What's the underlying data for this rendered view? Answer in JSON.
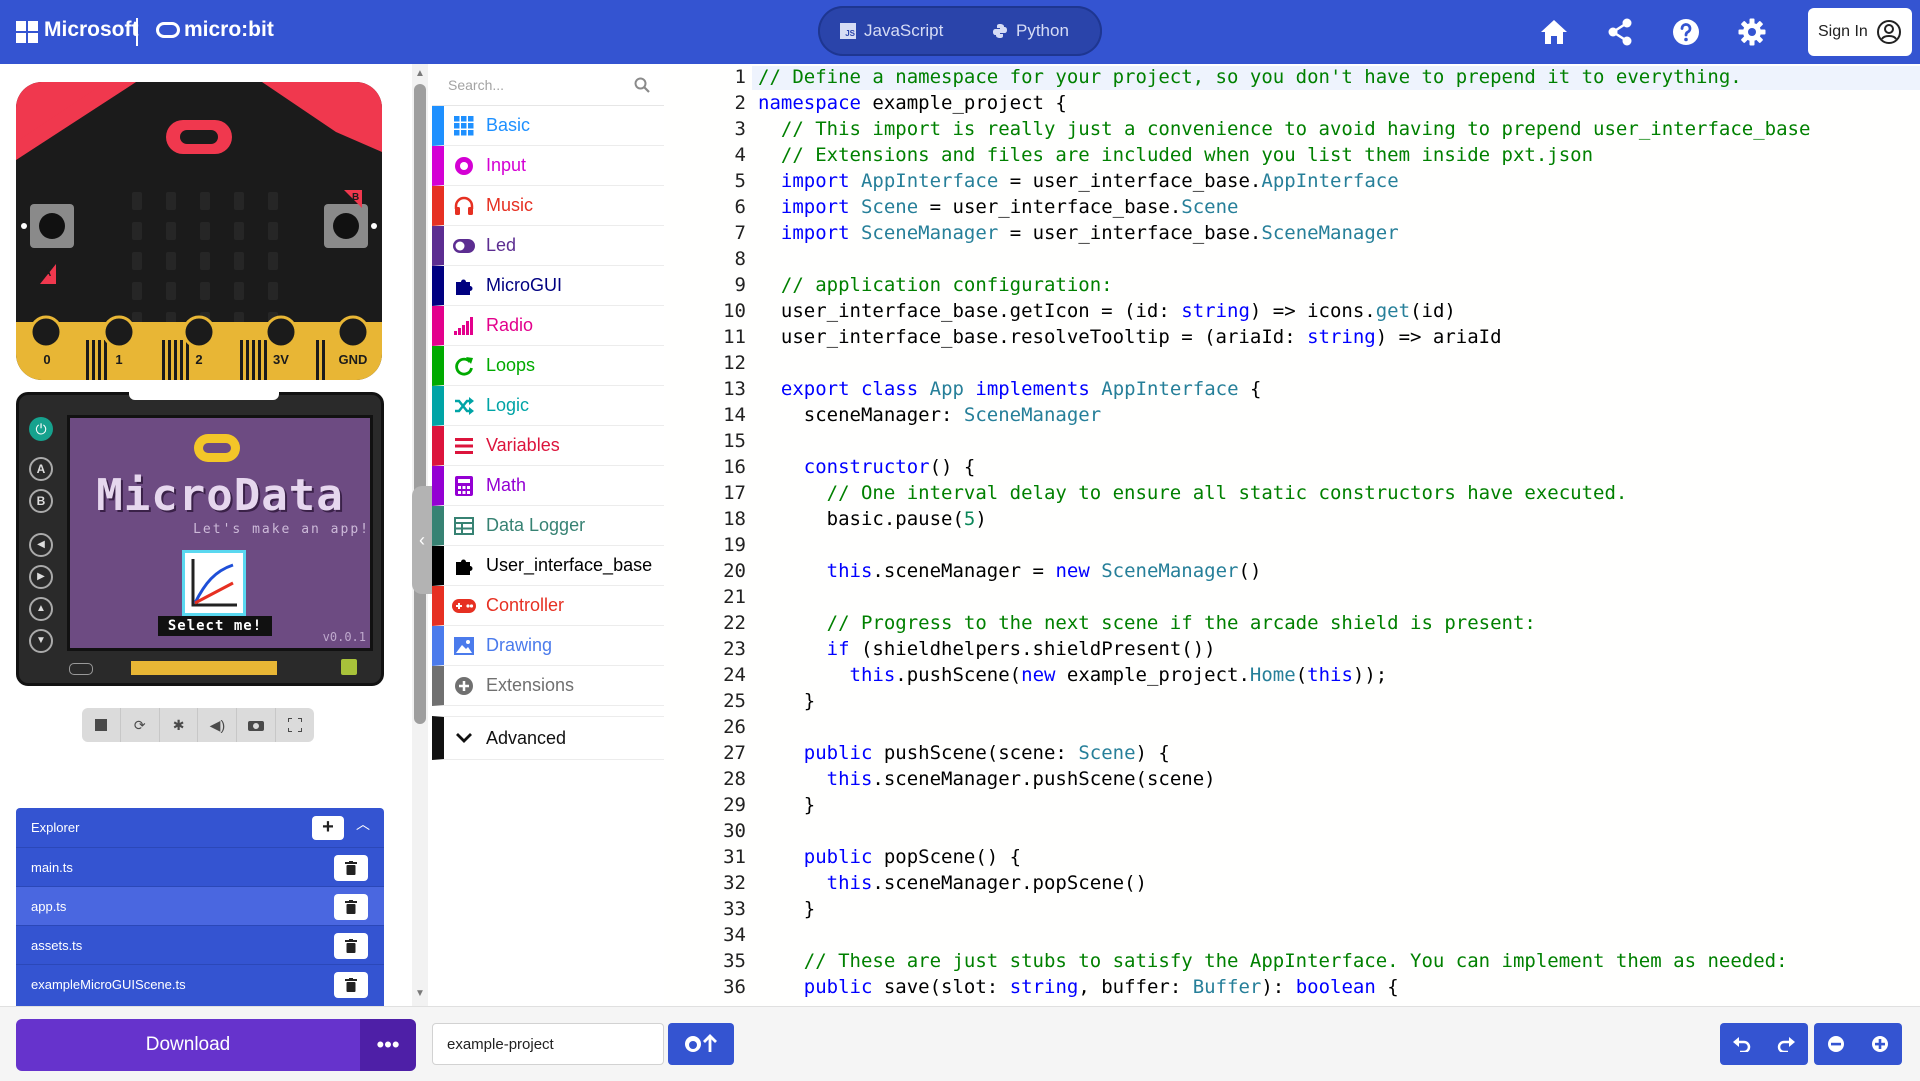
{
  "header": {
    "brand_ms": "Microsoft",
    "brand_microbit": "micro:bit",
    "lang_javascript": "JavaScript",
    "lang_python": "Python",
    "js_badge": "JS",
    "sign_in": "Sign In",
    "accent": "#3454d1"
  },
  "simulator": {
    "pins": [
      "0",
      "1",
      "2",
      "3V",
      "GND"
    ],
    "button_a": "A",
    "button_b": "B",
    "arcade_title": "MicroData",
    "arcade_subtitle": "Let's make an app!",
    "arcade_select": "Select me!",
    "arcade_version": "v0.0.1",
    "tools": [
      "stop-icon",
      "restart-icon",
      "debug-icon",
      "mute-icon",
      "screenshot-icon",
      "fullscreen-icon"
    ]
  },
  "explorer": {
    "title": "Explorer",
    "add": "+",
    "files": [
      "main.ts",
      "app.ts",
      "assets.ts",
      "exampleMicroGUIScene.ts"
    ]
  },
  "toolbox": {
    "search_placeholder": "Search...",
    "categories": [
      {
        "label": "Basic",
        "color": "#1e90ff"
      },
      {
        "label": "Input",
        "color": "#d400d4"
      },
      {
        "label": "Music",
        "color": "#e63022"
      },
      {
        "label": "Led",
        "color": "#5c2d91"
      },
      {
        "label": "MicroGUI",
        "color": "#000080"
      },
      {
        "label": "Radio",
        "color": "#e3008c"
      },
      {
        "label": "Loops",
        "color": "#00aa00"
      },
      {
        "label": "Logic",
        "color": "#00a4a6"
      },
      {
        "label": "Variables",
        "color": "#dc143c"
      },
      {
        "label": "Math",
        "color": "#9400d3"
      },
      {
        "label": "Data Logger",
        "color": "#378273"
      },
      {
        "label": "User_interface_base",
        "color": "#000000"
      },
      {
        "label": "Controller",
        "color": "#d65cd6"
      },
      {
        "label": "Drawing",
        "color": "#4b7bec"
      },
      {
        "label": "Extensions",
        "color": "#707070"
      }
    ],
    "advanced": "Advanced"
  },
  "editor": {
    "lines": [
      "// Define a namespace for your project, so you don't have to prepend it to everything.",
      "namespace example_project {",
      "  // This import is really just a convenience to avoid having to prepend user_interface_base",
      "  // Extensions and files are included when you list them inside pxt.json",
      "  import AppInterface = user_interface_base.AppInterface",
      "  import Scene = user_interface_base.Scene",
      "  import SceneManager = user_interface_base.SceneManager",
      "",
      "  // application configuration:",
      "  user_interface_base.getIcon = (id: string) => icons.get(id)",
      "  user_interface_base.resolveTooltip = (ariaId: string) => ariaId",
      "",
      "  export class App implements AppInterface {",
      "    sceneManager: SceneManager",
      "",
      "    constructor() {",
      "      // One interval delay to ensure all static constructors have executed.",
      "      basic.pause(5)",
      "",
      "      this.sceneManager = new SceneManager()",
      "",
      "      // Progress to the next scene if the arcade shield is present:",
      "      if (shieldhelpers.shieldPresent())",
      "        this.pushScene(new example_project.Home(this));",
      "    }",
      "",
      "    public pushScene(scene: Scene) {",
      "      this.sceneManager.pushScene(scene)",
      "    }",
      "",
      "    public popScene() {",
      "      this.sceneManager.popScene()",
      "    }",
      "",
      "    // These are just stubs to satisfy the AppInterface. You can implement them as needed:",
      "    public save(slot: string, buffer: Buffer): boolean {"
    ]
  },
  "bottombar": {
    "download": "Download",
    "more": "•••",
    "project_name": "example-project"
  }
}
